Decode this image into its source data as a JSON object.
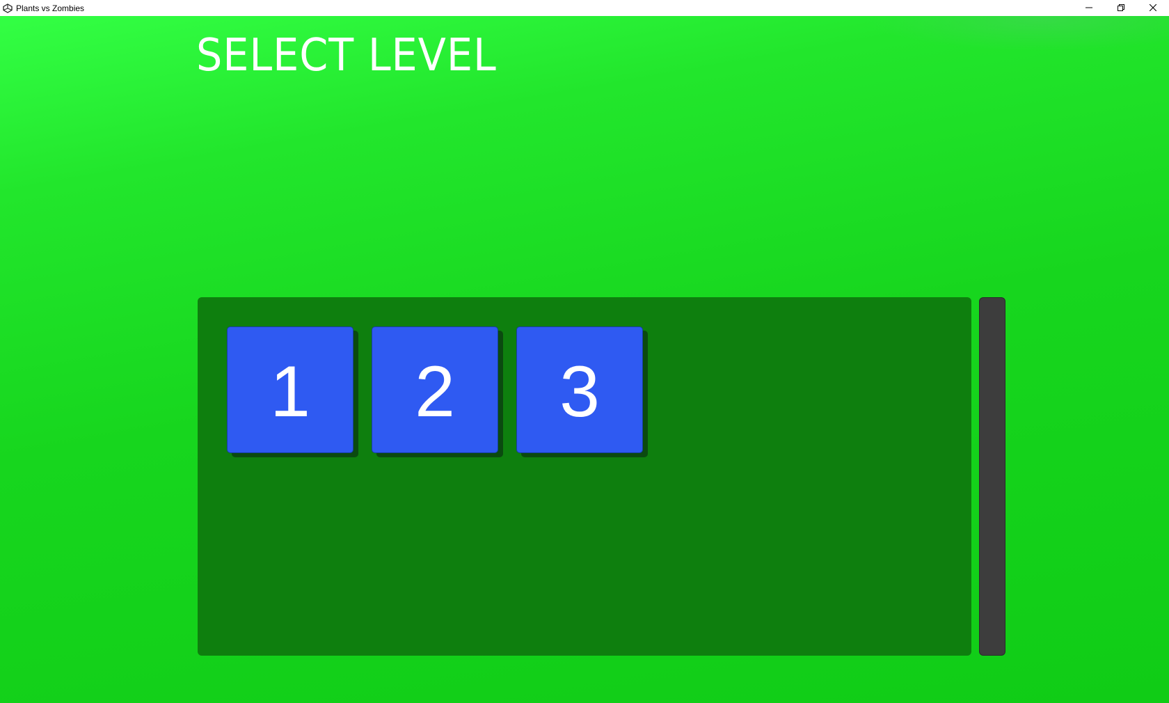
{
  "window": {
    "title": "Plants vs Zombies",
    "app_icon": "unity-icon",
    "controls": [
      "minimize-icon",
      "restore-icon",
      "close-icon"
    ]
  },
  "header": {
    "title": "SELECT LEVEL"
  },
  "levels": [
    {
      "label": "1"
    },
    {
      "label": "2"
    },
    {
      "label": "3"
    }
  ],
  "colors": {
    "background": "#17d61e",
    "panel": "#0e7f0e",
    "level_button": "#2f5af2",
    "scrollbar": "#3d3d3d",
    "title_text": "#ffffff"
  }
}
